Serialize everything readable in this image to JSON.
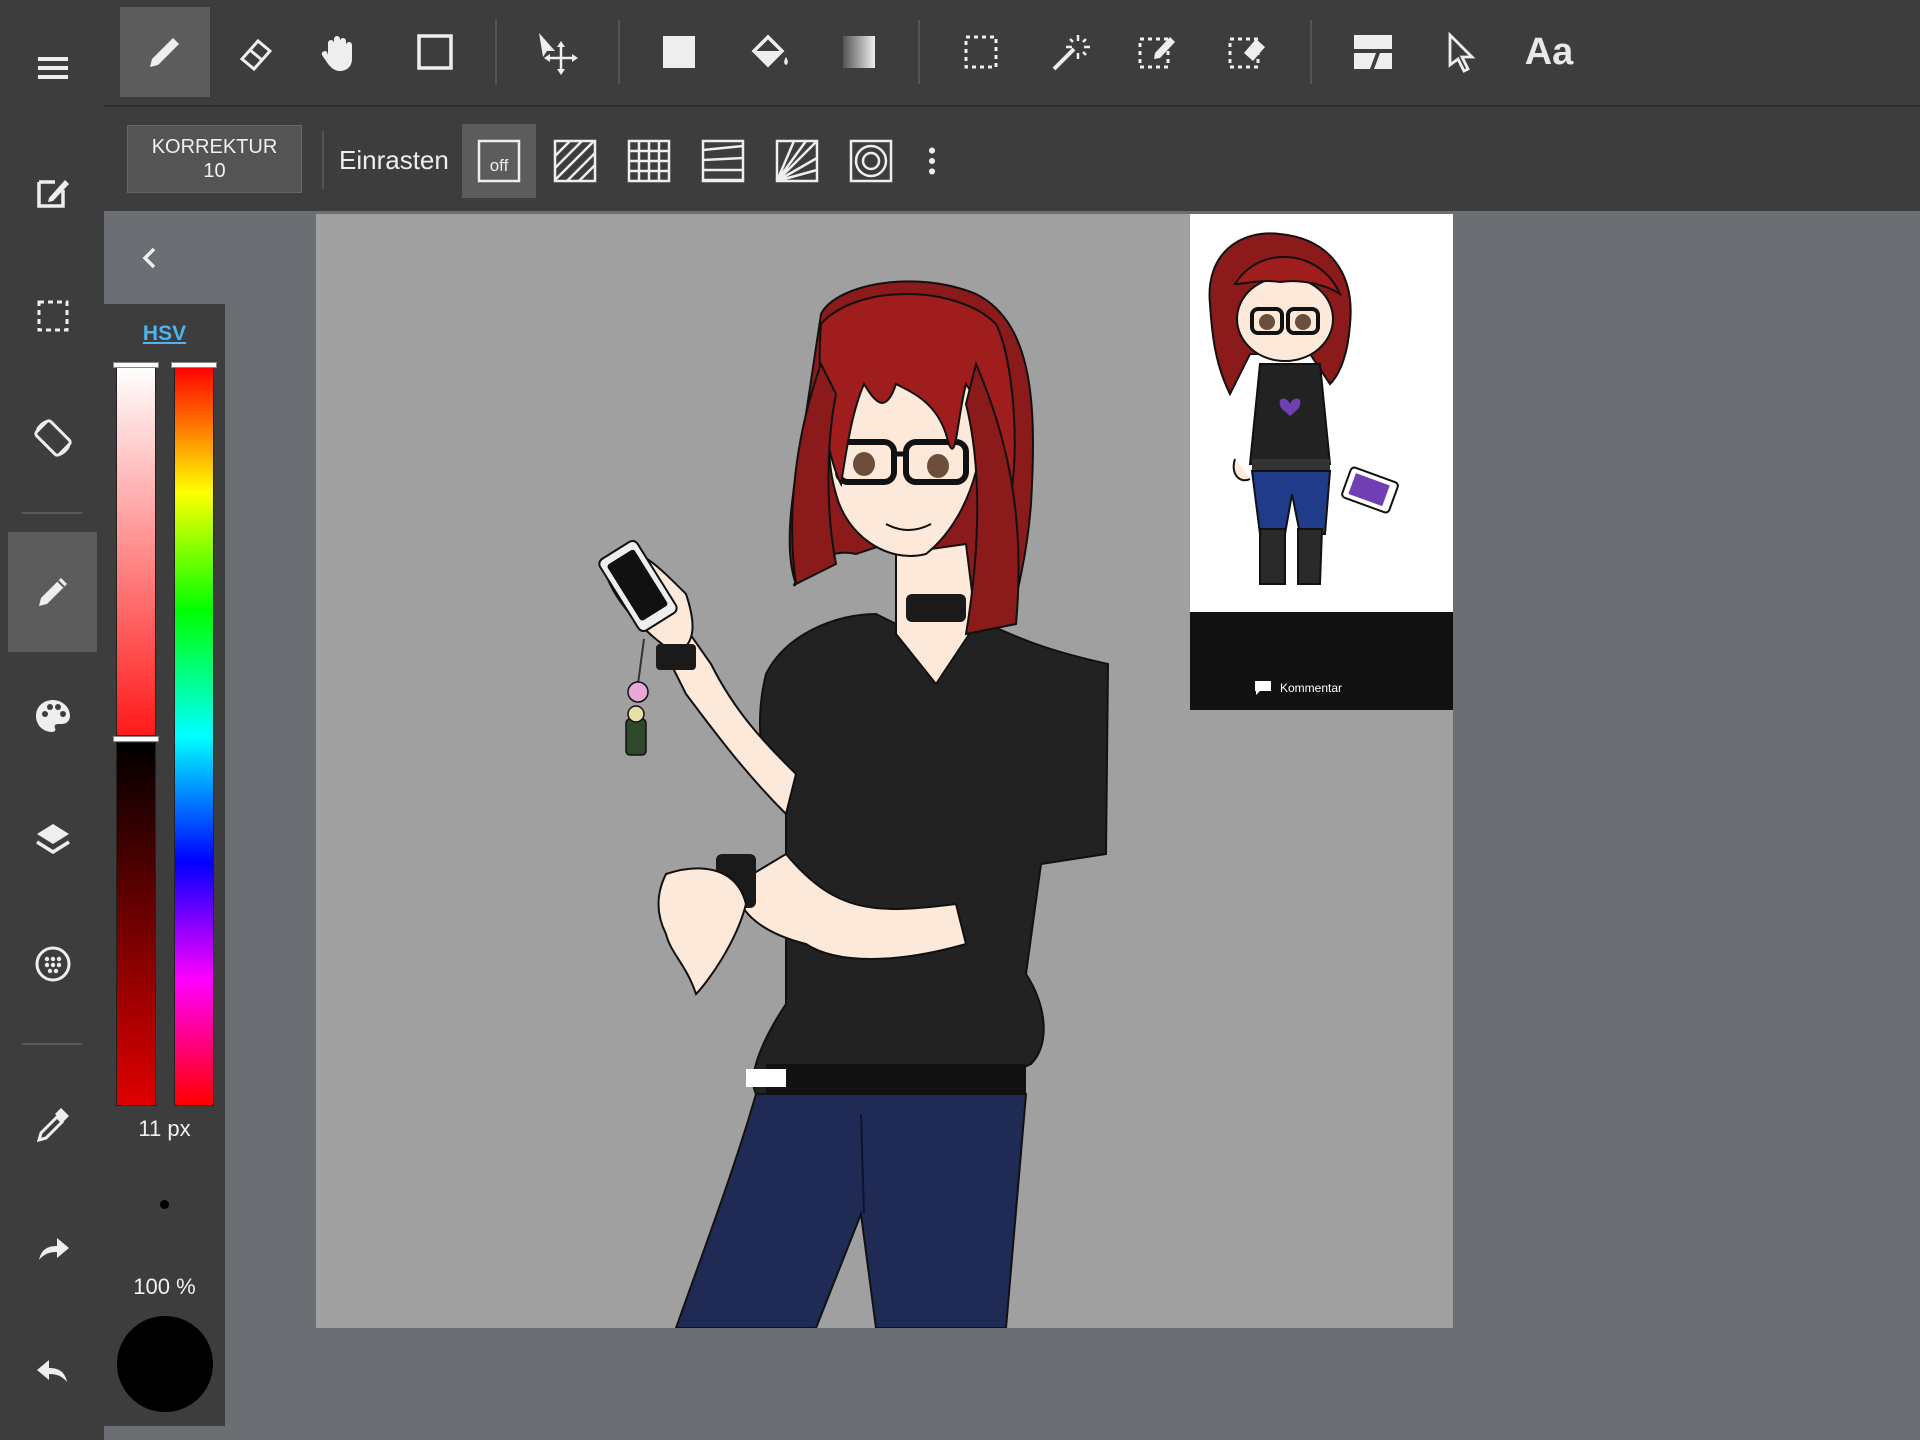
{
  "app": {
    "accent_color": "#5c5c5c",
    "toolbar_bg": "#3d3d3d",
    "workspace_bg": "#6b6e73",
    "canvas_bg": "#a0a0a0"
  },
  "left_toolbar": {
    "items": [
      {
        "icon": "menu-icon",
        "active": false
      },
      {
        "icon": "edit-note-icon",
        "active": false
      },
      {
        "icon": "selection-icon",
        "active": false
      },
      {
        "icon": "rotate-icon",
        "active": false
      },
      {
        "icon": "pen-icon",
        "active": true
      },
      {
        "icon": "palette-icon",
        "active": false
      },
      {
        "icon": "layers-icon",
        "active": false
      },
      {
        "icon": "material-icon",
        "active": false
      },
      {
        "icon": "eyedropper-icon",
        "active": false
      },
      {
        "icon": "redo-icon",
        "active": false
      },
      {
        "icon": "undo-icon",
        "active": false
      }
    ]
  },
  "top_toolbar": {
    "tools": [
      {
        "icon": "pen-icon",
        "active": true
      },
      {
        "icon": "eraser-icon",
        "active": false
      },
      {
        "icon": "hand-icon",
        "active": false
      },
      {
        "icon": "rectangle-icon",
        "active": false
      },
      {
        "icon": "move-icon",
        "active": false
      },
      {
        "icon": "fill-rectangle-icon",
        "active": false
      },
      {
        "icon": "bucket-icon",
        "active": false
      },
      {
        "icon": "gradient-icon",
        "active": false
      },
      {
        "icon": "select-rectangle-icon",
        "active": false
      },
      {
        "icon": "magic-wand-icon",
        "active": false
      },
      {
        "icon": "select-pen-icon",
        "active": false
      },
      {
        "icon": "select-eraser-icon",
        "active": false
      },
      {
        "icon": "panel-icon",
        "active": false
      },
      {
        "icon": "pointer-icon",
        "active": false
      }
    ],
    "text_tool_label": "Aa"
  },
  "sub_toolbar": {
    "korrektur_label": "KORREKTUR",
    "korrektur_value": "10",
    "snap_label": "Einrasten",
    "snap_off_label": "off",
    "snap_options": [
      "parallel",
      "grid",
      "perspective-horizontal",
      "radial",
      "concentric"
    ],
    "more_icon": "more-vertical-icon"
  },
  "color_panel": {
    "mode_label": "HSV",
    "brush_size": "11 px",
    "opacity": "100 %",
    "current_color": "#000000",
    "collapse_icon": "chevron-left-icon"
  },
  "reference": {
    "comment_label": "Kommentar"
  }
}
